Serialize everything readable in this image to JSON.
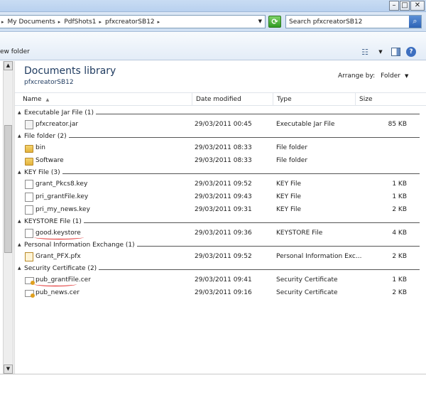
{
  "window": {
    "controls": [
      "minimize",
      "maximize",
      "close"
    ]
  },
  "address": {
    "crumbs": [
      "My Documents",
      "PdfShots1",
      "pfxcreatorSB12"
    ],
    "search_placeholder": "Search pfxcreatorSB12"
  },
  "toolbar": {
    "new_folder": "ew folder"
  },
  "library": {
    "title": "Documents library",
    "subtitle": "pfxcreatorSB12",
    "arrange_label": "Arrange by:",
    "arrange_value": "Folder"
  },
  "columns": {
    "name": "Name",
    "date": "Date modified",
    "type": "Type",
    "size": "Size"
  },
  "groups": [
    {
      "label": "Executable Jar File (1)",
      "files": [
        {
          "name": "pfxcreator.jar",
          "date": "29/03/2011 00:45",
          "type": "Executable Jar File",
          "size": "85 KB",
          "icon": "jar-icon"
        }
      ]
    },
    {
      "label": "File folder (2)",
      "files": [
        {
          "name": "bin",
          "date": "29/03/2011 08:33",
          "type": "File folder",
          "size": "",
          "icon": "folder-icon"
        },
        {
          "name": "Software",
          "date": "29/03/2011 08:33",
          "type": "File folder",
          "size": "",
          "icon": "folder-icon"
        }
      ]
    },
    {
      "label": "KEY File (3)",
      "files": [
        {
          "name": "grant_Pkcs8.key",
          "date": "29/03/2011 09:52",
          "type": "KEY File",
          "size": "1 KB",
          "icon": "document-icon"
        },
        {
          "name": "pri_grantFile.key",
          "date": "29/03/2011 09:43",
          "type": "KEY File",
          "size": "1 KB",
          "icon": "document-icon"
        },
        {
          "name": "pri_my_news.key",
          "date": "29/03/2011 09:31",
          "type": "KEY File",
          "size": "2 KB",
          "icon": "document-icon"
        }
      ]
    },
    {
      "label": "KEYSTORE File (1)",
      "files": [
        {
          "name": "good.keystore",
          "date": "29/03/2011 09:36",
          "type": "KEYSTORE File",
          "size": "4 KB",
          "icon": "document-icon"
        }
      ]
    },
    {
      "label": "Personal Information Exchange (1)",
      "files": [
        {
          "name": "Grant_PFX.pfx",
          "date": "29/03/2011 09:52",
          "type": "Personal Information Exc...",
          "size": "2 KB",
          "icon": "certificate-key-icon"
        }
      ]
    },
    {
      "label": "Security Certificate (2)",
      "files": [
        {
          "name": "pub_grantFile.cer",
          "date": "29/03/2011 09:41",
          "type": "Security Certificate",
          "size": "1 KB",
          "icon": "certificate-icon"
        },
        {
          "name": "pub_news.cer",
          "date": "29/03/2011 09:16",
          "type": "Security Certificate",
          "size": "2 KB",
          "icon": "certificate-icon"
        }
      ]
    }
  ]
}
